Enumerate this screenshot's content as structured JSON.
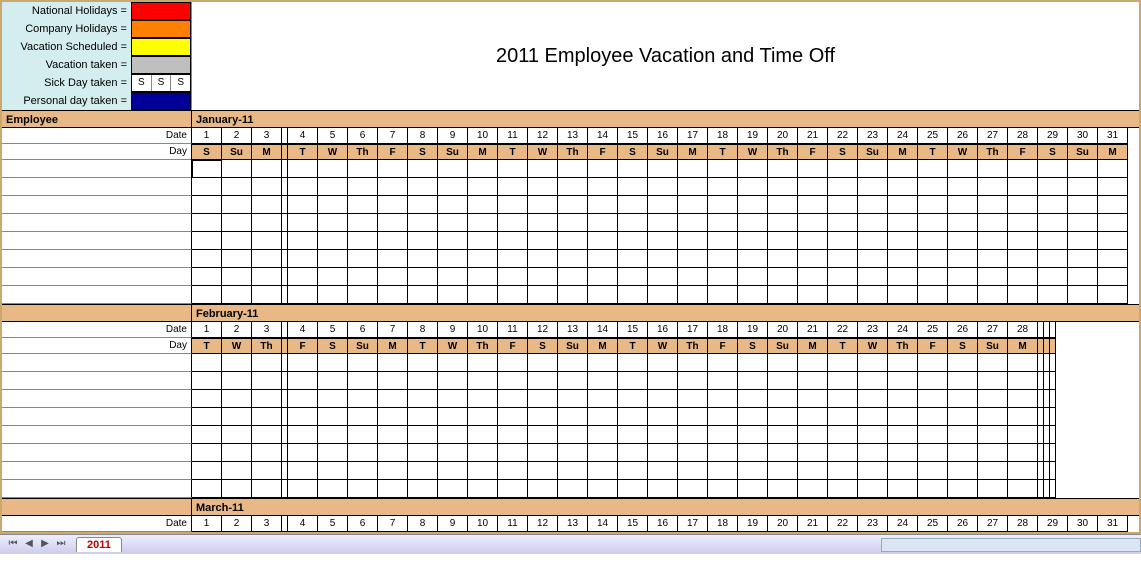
{
  "title": "2011 Employee Vacation and Time Off",
  "legend": {
    "national": {
      "label": "National Holidays =",
      "color": "#ff0000"
    },
    "company": {
      "label": "Company Holidays =",
      "color": "#ff7f00"
    },
    "vac_sched": {
      "label": "Vacation Scheduled =",
      "color": "#ffff00"
    },
    "vac_taken": {
      "label": "Vacation taken =",
      "color": "#bfbfbf"
    },
    "sick": {
      "label": "Sick Day taken =",
      "marker": "S"
    },
    "personal": {
      "label": "Personal day taken =",
      "color": "#000099"
    }
  },
  "employee_header": "Employee",
  "date_label": "Date",
  "day_label": "Day",
  "months": [
    {
      "name": "January-11",
      "show_employee_header": true,
      "dates": [
        "1",
        "2",
        "3",
        "",
        "4",
        "5",
        "6",
        "7",
        "8",
        "9",
        "10",
        "11",
        "12",
        "13",
        "14",
        "15",
        "16",
        "17",
        "18",
        "19",
        "20",
        "21",
        "22",
        "23",
        "24",
        "25",
        "26",
        "27",
        "28",
        "29",
        "30",
        "31"
      ],
      "days": [
        "S",
        "Su",
        "M",
        "",
        "T",
        "W",
        "Th",
        "F",
        "S",
        "Su",
        "M",
        "T",
        "W",
        "Th",
        "F",
        "S",
        "Su",
        "M",
        "T",
        "W",
        "Th",
        "F",
        "S",
        "Su",
        "M",
        "T",
        "W",
        "Th",
        "F",
        "S",
        "Su",
        "M"
      ],
      "employee_rows": 8
    },
    {
      "name": "February-11",
      "show_employee_header": false,
      "dates": [
        "1",
        "2",
        "3",
        "",
        "4",
        "5",
        "6",
        "7",
        "8",
        "9",
        "10",
        "11",
        "12",
        "13",
        "14",
        "15",
        "16",
        "17",
        "18",
        "19",
        "20",
        "21",
        "22",
        "23",
        "24",
        "25",
        "26",
        "27",
        "28",
        "",
        "",
        ""
      ],
      "days": [
        "T",
        "W",
        "Th",
        "",
        "F",
        "S",
        "Su",
        "M",
        "T",
        "W",
        "Th",
        "F",
        "S",
        "Su",
        "M",
        "T",
        "W",
        "Th",
        "F",
        "S",
        "Su",
        "M",
        "T",
        "W",
        "Th",
        "F",
        "S",
        "Su",
        "M",
        "",
        "",
        ""
      ],
      "employee_rows": 8
    },
    {
      "name": "March-11",
      "show_employee_header": false,
      "dates": [
        "1",
        "2",
        "3",
        "",
        "4",
        "5",
        "6",
        "7",
        "8",
        "9",
        "10",
        "11",
        "12",
        "13",
        "14",
        "15",
        "16",
        "17",
        "18",
        "19",
        "20",
        "21",
        "22",
        "23",
        "24",
        "25",
        "26",
        "27",
        "28",
        "29",
        "30",
        "31"
      ],
      "days": [],
      "employee_rows": 0
    }
  ],
  "tab": {
    "name": "2011"
  }
}
